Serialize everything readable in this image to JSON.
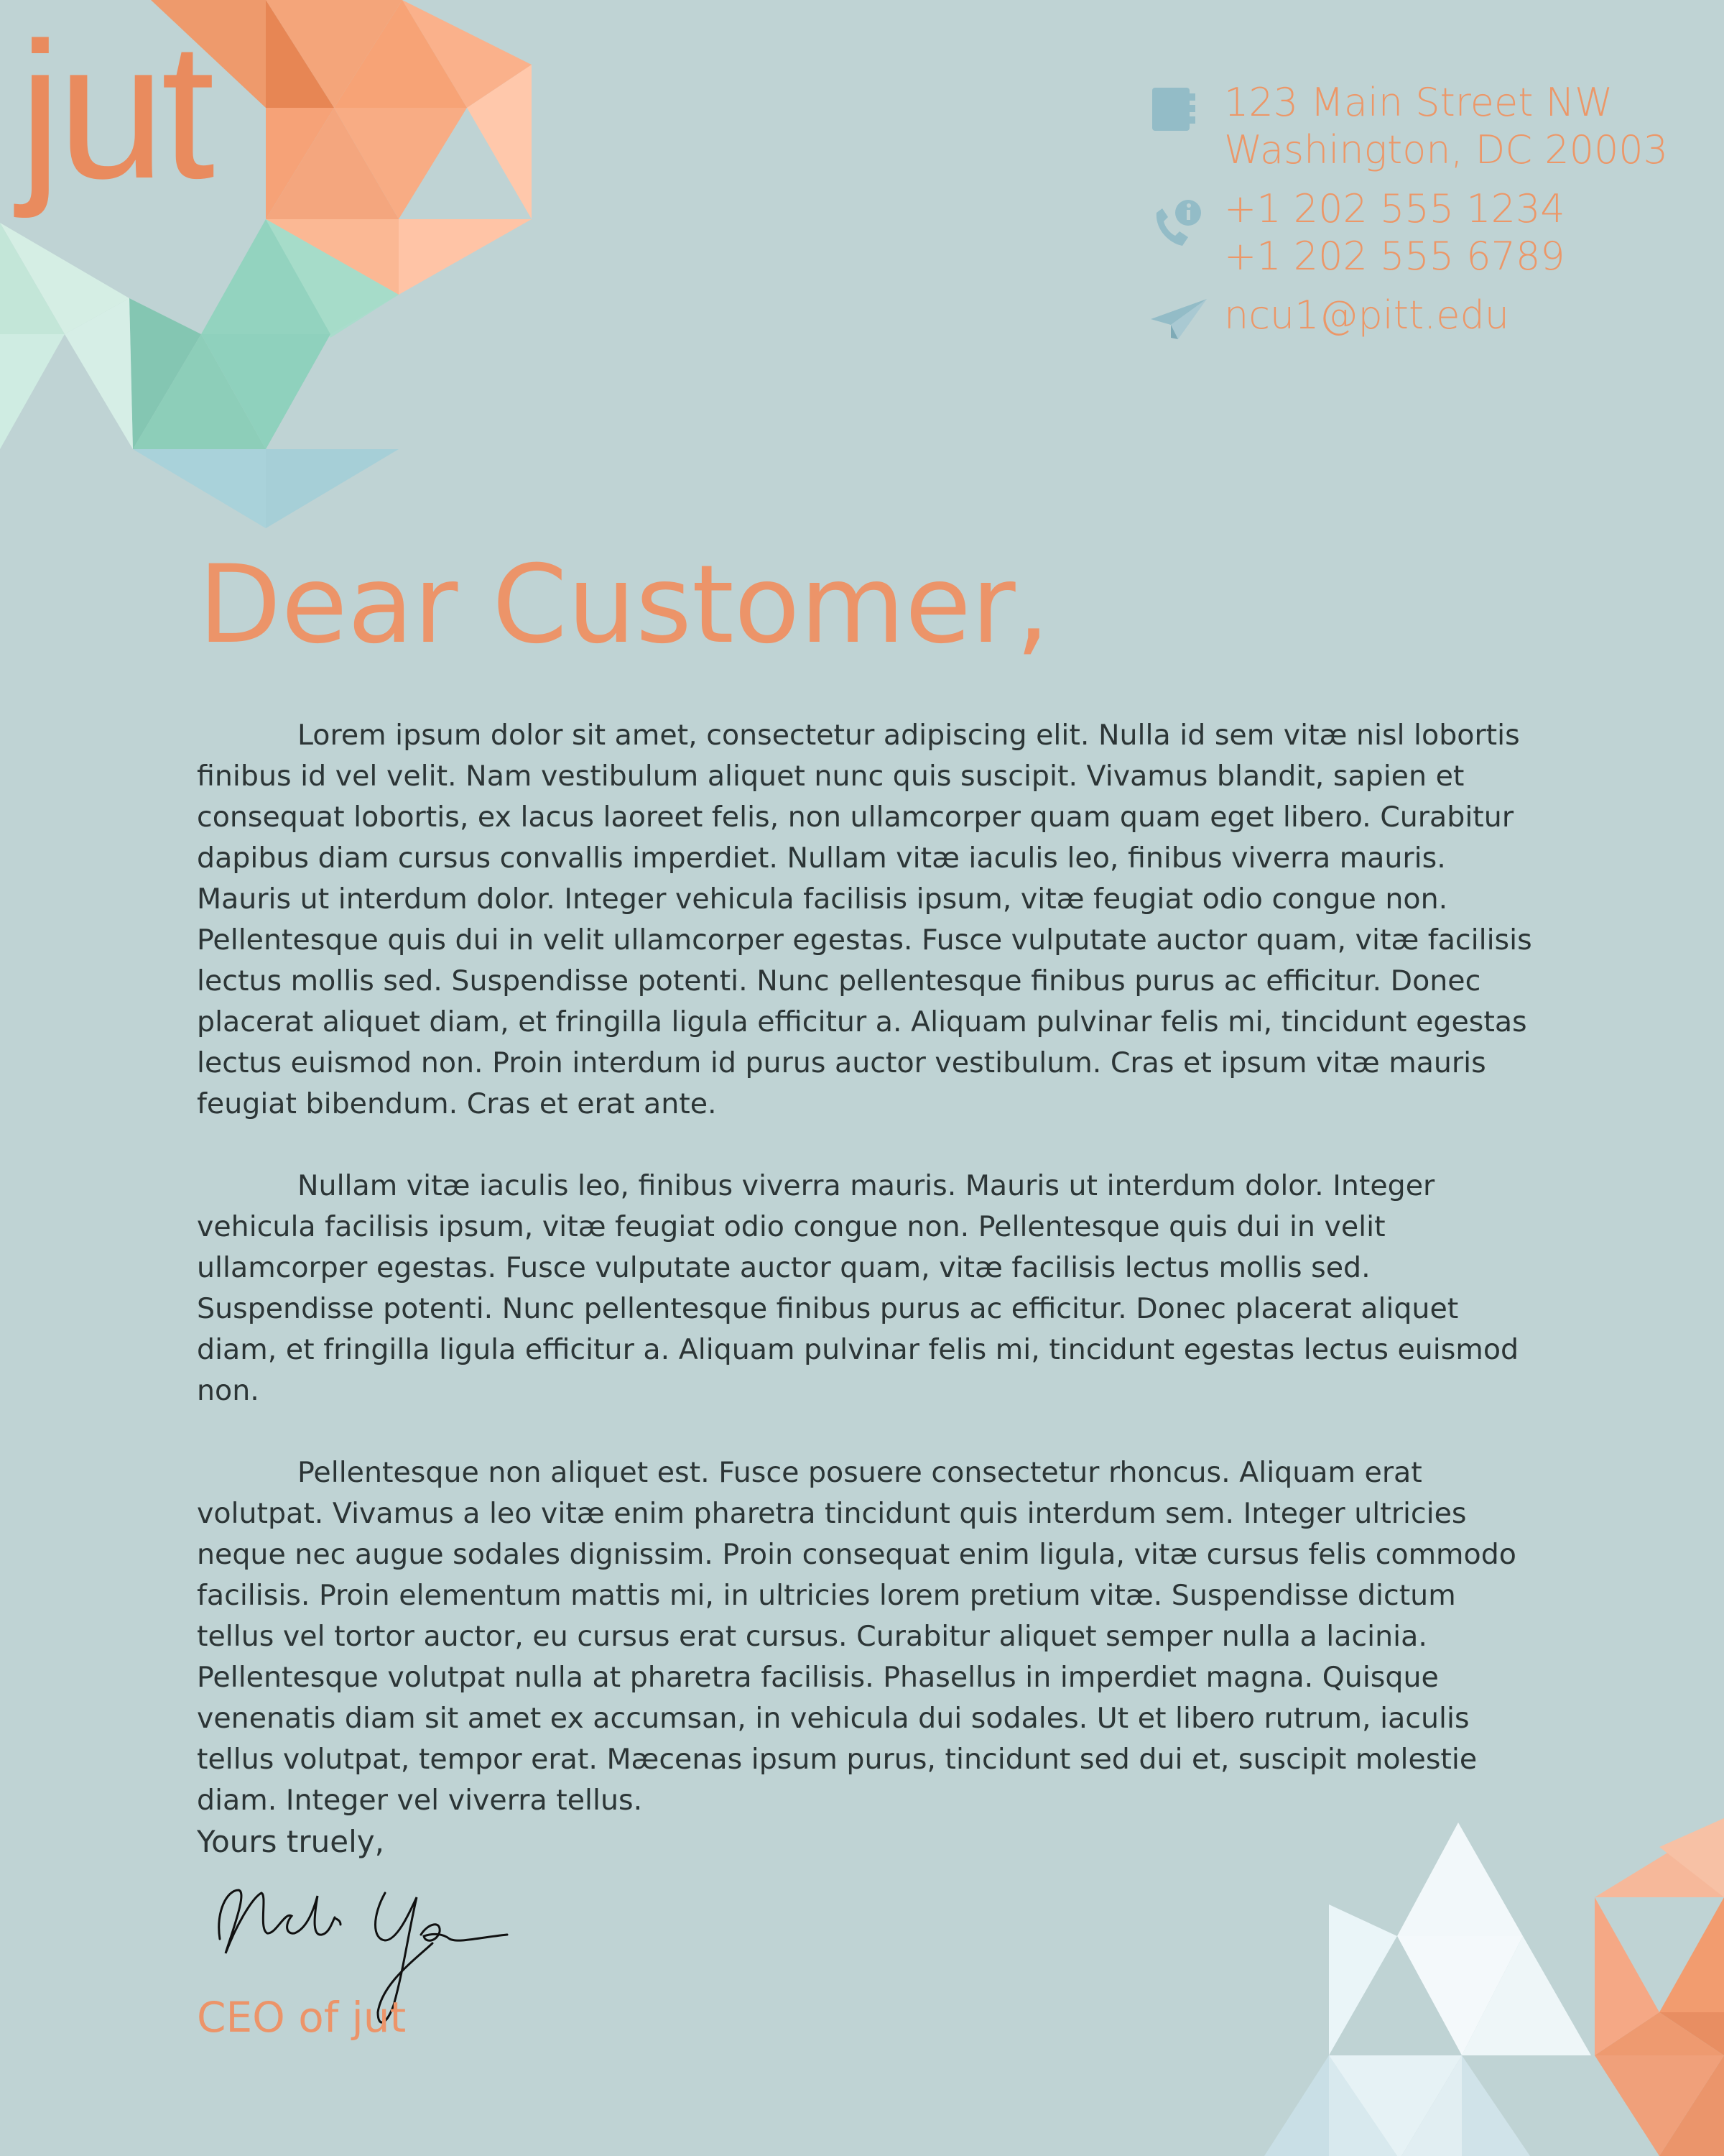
{
  "brand": {
    "logo_text": "jut"
  },
  "contact": {
    "address_line1": "123 Main Street NW",
    "address_line2": "Washington, DC 20003",
    "phone1": "+1 202 555 1234",
    "phone2": "+1 202 555 6789",
    "email": "ncu1@pitt.edu",
    "icons": [
      "address-book-icon",
      "phone-info-icon",
      "paper-plane-icon"
    ]
  },
  "letter": {
    "greeting": "Dear Customer,",
    "paragraphs": [
      "Lorem ipsum dolor sit amet, consectetur adipiscing elit. Nulla id sem vitæ nisl lobortis finibus id vel velit. Nam vestibulum aliquet nunc quis suscipit. Vivamus blandit, sapien et consequat lobortis, ex lacus laoreet felis, non ullamcorper quam quam eget libero. Curabitur dapibus diam cursus convallis imperdiet. Nullam vitæ iaculis leo, finibus viverra mauris. Mauris ut interdum dolor. Integer vehicula facilisis ipsum, vitæ feugiat odio congue non. Pellentesque quis dui in velit ullamcorper egestas. Fusce vulputate auctor quam, vitæ facilisis lectus mollis sed. Suspendisse potenti. Nunc pellentesque finibus purus ac efficitur. Donec placerat aliquet diam, et fringilla ligula efficitur a. Aliquam pulvinar felis mi, tincidunt egestas lectus euismod non. Proin interdum id purus auctor vestibulum. Cras et ipsum vitæ mauris feugiat bibendum. Cras et erat ante.",
      "Nullam vitæ iaculis leo, finibus viverra mauris. Mauris ut interdum dolor. Integer vehicula facilisis ipsum, vitæ feugiat odio congue non. Pellentesque quis dui in velit ullamcorper egestas. Fusce vulputate auctor quam, vitæ facilisis lectus mollis sed. Suspendisse potenti. Nunc pellentesque finibus purus ac efficitur. Donec placerat aliquet diam, et fringilla ligula efficitur a. Aliquam pulvinar felis mi, tincidunt egestas lectus euismod non.",
      "Pellentesque non aliquet est. Fusce posuere consectetur rhoncus. Aliquam erat volutpat. Vivamus a leo vitæ enim pharetra tincidunt quis interdum sem. Integer ultricies neque nec augue sodales dignissim. Proin consequat enim ligula, vitæ cursus felis commodo facilisis. Proin elementum mattis mi, in ultricies lorem pretium vitæ. Suspendisse dictum tellus vel tortor auctor, eu cursus erat cursus. Curabitur aliquet semper nulla a lacinia. Pellentesque volutpat nulla at pharetra facilisis. Phasellus in imperdiet magna. Quisque venenatis diam sit amet ex accumsan, in vehicula dui sodales. Ut et libero rutrum, iaculis tellus volutpat, tempor erat. Mæcenas ipsum purus, tincidunt sed dui et, suscipit molestie diam. Integer vel viverra tellus."
    ],
    "closing": "Yours truely,",
    "signer_role": "CEO of jut"
  },
  "colors": {
    "background": "#bfd3d4",
    "accent_orange": "#ec9469",
    "text": "#2c3536",
    "icon_blue": "#93bcc7"
  }
}
